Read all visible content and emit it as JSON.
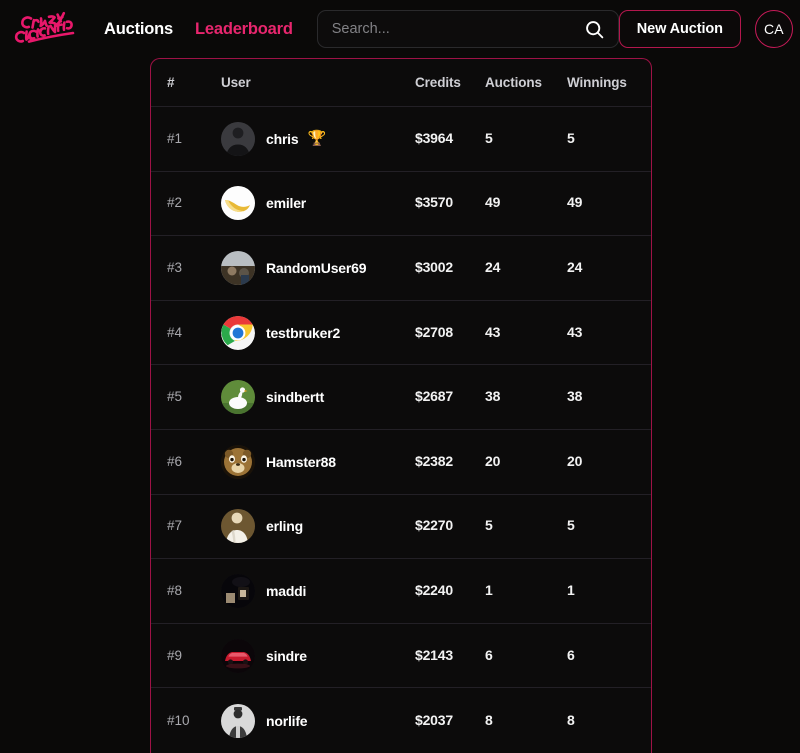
{
  "brand": {
    "logo_text": "Crazy Auction",
    "logo_line1": "Crazy",
    "logo_line2": "AUCTION",
    "logo_color": "#e8186b"
  },
  "header": {
    "nav": [
      {
        "label": "Auctions",
        "active": false
      },
      {
        "label": "Leaderboard",
        "active": true
      }
    ],
    "search": {
      "placeholder": "Search...",
      "value": "",
      "icon": "search-icon"
    },
    "new_auction_label": "New Auction",
    "account_initials": "CA",
    "accent_color": "#e8266e"
  },
  "leaderboard": {
    "columns": [
      "#",
      "User",
      "Credits",
      "Auctions",
      "Winnings"
    ],
    "rows": [
      {
        "rank": "#1",
        "user": "chris",
        "credits": "$3964",
        "auctions": "5",
        "winnings": "5",
        "trophy": "🏆",
        "avatar": "statue-photo"
      },
      {
        "rank": "#2",
        "user": "emiler",
        "credits": "$3570",
        "auctions": "49",
        "winnings": "49",
        "trophy": "",
        "avatar": "banana"
      },
      {
        "rank": "#3",
        "user": "RandomUser69",
        "credits": "$3002",
        "auctions": "24",
        "winnings": "24",
        "trophy": "",
        "avatar": "crowd-photo"
      },
      {
        "rank": "#4",
        "user": "testbruker2",
        "credits": "$2708",
        "auctions": "43",
        "winnings": "43",
        "trophy": "",
        "avatar": "chrome-logo"
      },
      {
        "rank": "#5",
        "user": "sindbertt",
        "credits": "$2687",
        "auctions": "38",
        "winnings": "38",
        "trophy": "",
        "avatar": "goose"
      },
      {
        "rank": "#6",
        "user": "Hamster88",
        "credits": "$2382",
        "auctions": "20",
        "winnings": "20",
        "trophy": "",
        "avatar": "hamster"
      },
      {
        "rank": "#7",
        "user": "erling",
        "credits": "$2270",
        "auctions": "5",
        "winnings": "5",
        "trophy": "",
        "avatar": "person-white"
      },
      {
        "rank": "#8",
        "user": "maddi",
        "credits": "$2240",
        "auctions": "1",
        "winnings": "1",
        "trophy": "",
        "avatar": "dark-photo"
      },
      {
        "rank": "#9",
        "user": "sindre",
        "credits": "$2143",
        "auctions": "6",
        "winnings": "6",
        "trophy": "",
        "avatar": "red-car"
      },
      {
        "rank": "#10",
        "user": "norlife",
        "credits": "$2037",
        "auctions": "8",
        "winnings": "8",
        "trophy": "",
        "avatar": "person-gray"
      }
    ]
  }
}
